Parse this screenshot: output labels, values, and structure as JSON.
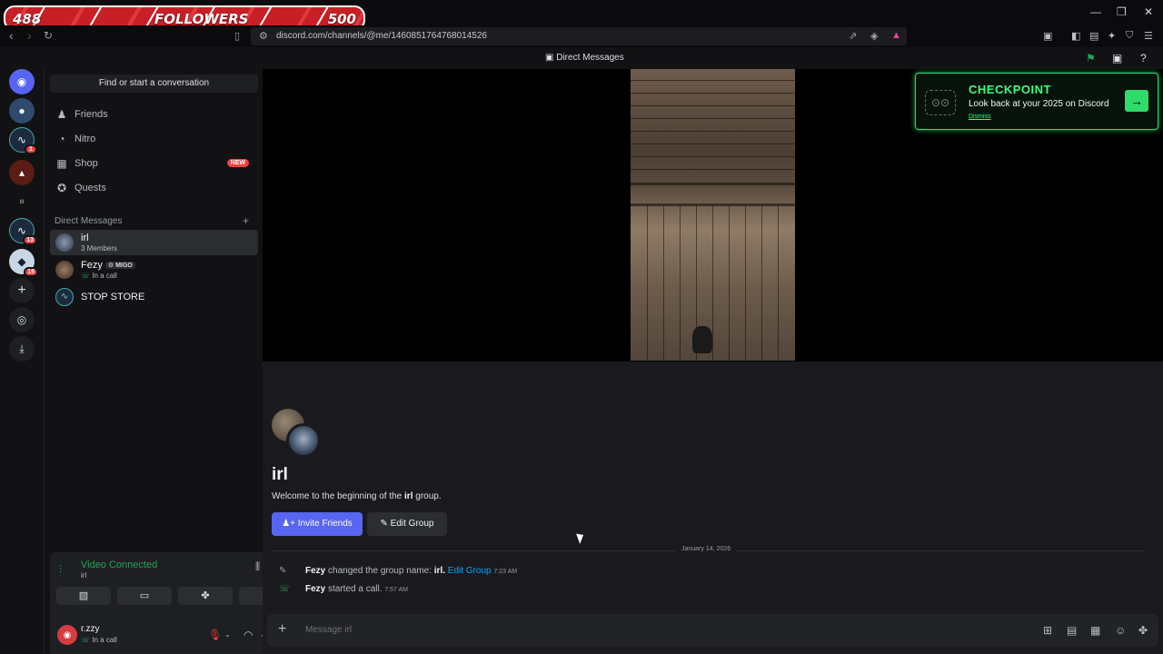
{
  "overlay": {
    "followers_current": "488",
    "followers_label": "FOLLOWERS",
    "followers_goal": "500"
  },
  "browser": {
    "url": "discord.com/channels/@me/1460851764768014526",
    "window_controls": [
      "—",
      "❐",
      "✕"
    ]
  },
  "titlebar": {
    "title": "Direct Messages"
  },
  "rail": {
    "badges": [
      "1",
      "13",
      "16"
    ]
  },
  "sidebar": {
    "find_placeholder": "Find or start a conversation",
    "nav": [
      {
        "label": "Friends",
        "icon": "friends-icon"
      },
      {
        "label": "Nitro",
        "icon": "nitro-icon"
      },
      {
        "label": "Shop",
        "icon": "shop-icon",
        "badge": "NEW"
      },
      {
        "label": "Quests",
        "icon": "quests-icon"
      }
    ],
    "dm_header": "Direct Messages",
    "dms": [
      {
        "name": "irl",
        "sub": "3 Members"
      },
      {
        "name": "Fezy",
        "tag": "MIGO",
        "sub": "In a call"
      },
      {
        "name": "STOP STORE",
        "sub": ""
      }
    ]
  },
  "voice": {
    "title": "Video Connected",
    "channel": "irl"
  },
  "user": {
    "name": "r.zzy",
    "status": "In a call"
  },
  "checkpoint": {
    "title": "CHECKPOINT",
    "subtitle": "Look back at your 2025 on Discord",
    "dismiss": "Dismiss",
    "accent": "#37ff7a"
  },
  "group": {
    "name": "irl",
    "welcome_prefix": "Welcome to the beginning of the ",
    "welcome_name": "irl",
    "welcome_suffix": " group.",
    "invite_label": "Invite Friends",
    "edit_label": "Edit Group"
  },
  "messages": {
    "date": "January 14, 2026",
    "rows": [
      {
        "author": "Fezy",
        "text": "changed the group name: ",
        "target": "irl.",
        "link": "Edit Group",
        "time": "7:23 AM"
      },
      {
        "author": "Fezy",
        "text": "started a call.",
        "time": "7:57 AM"
      }
    ]
  },
  "composer": {
    "placeholder": "Message irl"
  },
  "colors": {
    "blurple": "#5865f2",
    "green": "#23a55a",
    "red": "#f23f43",
    "link": "#00a8fc"
  }
}
